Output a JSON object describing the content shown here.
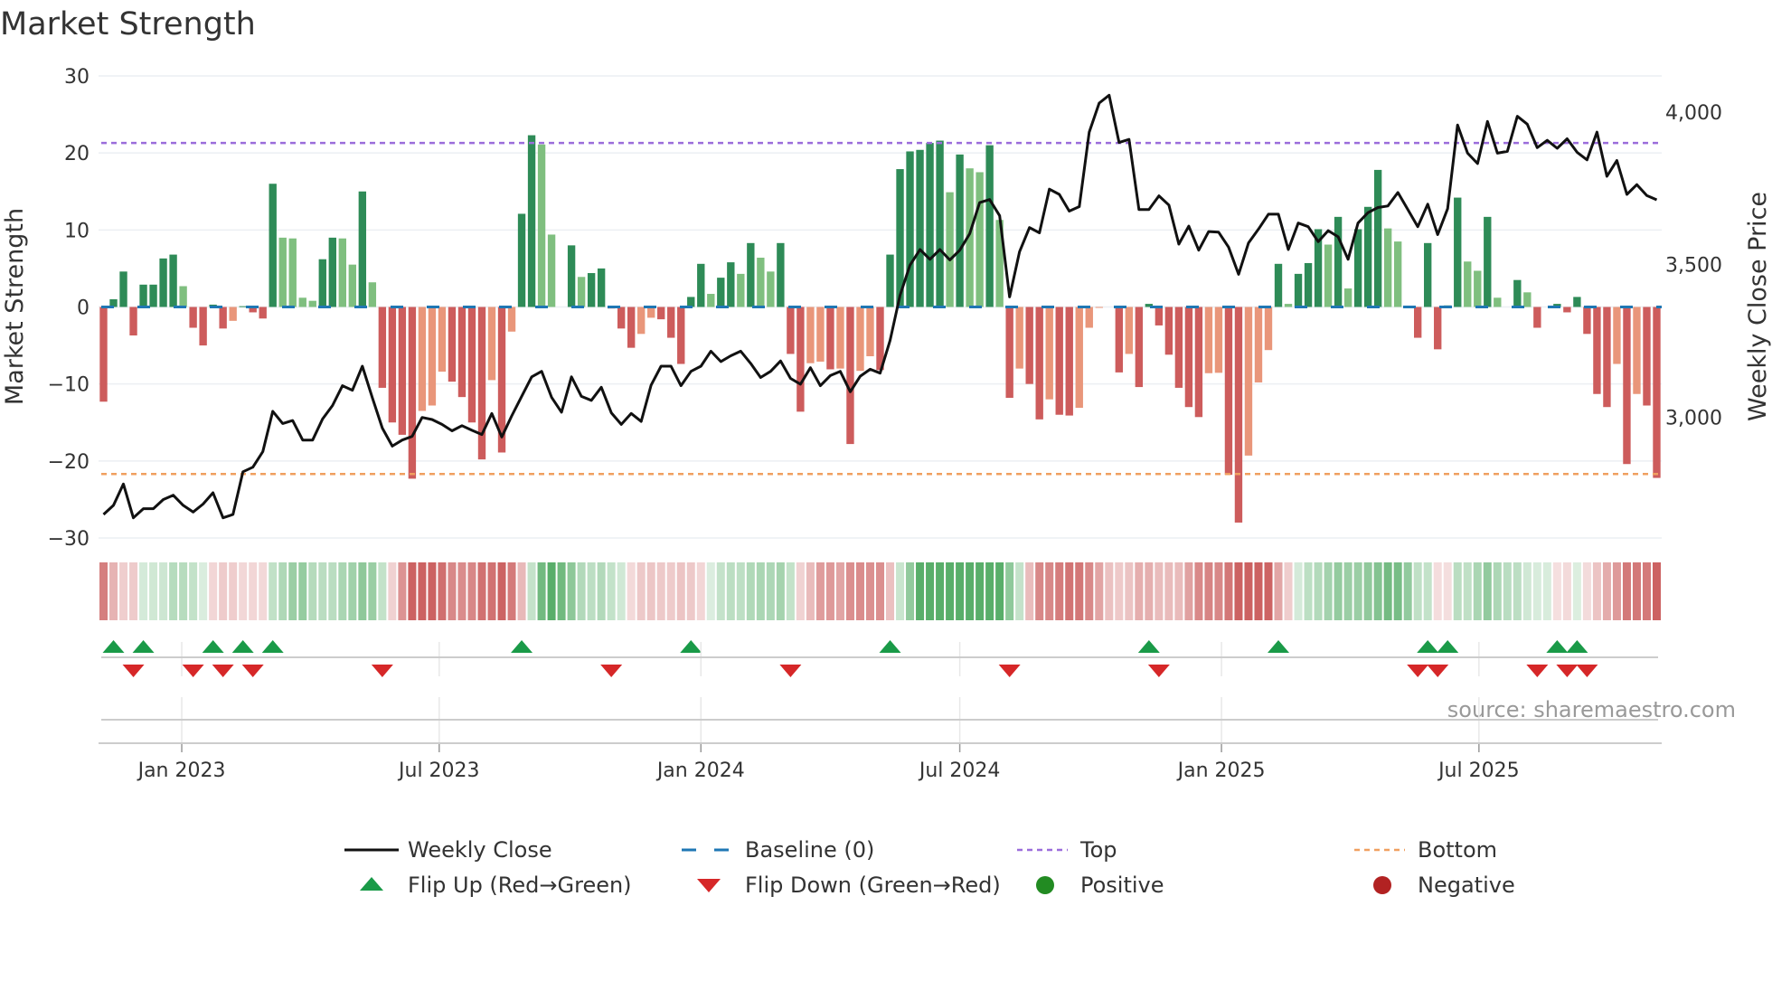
{
  "chart_data": {
    "type": "bar",
    "title": "Market Strength",
    "ylabel": "Market Strength",
    "ylabel_right": "Weekly Close Price",
    "source": "source: sharemaestro.com",
    "ylim": [
      -30,
      30
    ],
    "yticks": [
      30,
      20,
      10,
      0,
      -10,
      -20,
      -30
    ],
    "ytick_labels": [
      "30",
      "20",
      "10",
      "0",
      "−10",
      "−20",
      "−30"
    ],
    "ylim_right": [
      2604,
      4118
    ],
    "yticks_right": [
      4000,
      3500,
      3000
    ],
    "ytick_labels_right": [
      "4,000",
      "3,500",
      "3,000"
    ],
    "xticks": [
      {
        "date": "2023-01-01",
        "label": "Jan 2023"
      },
      {
        "date": "2023-07-01",
        "label": "Jul 2023"
      },
      {
        "date": "2024-01-01",
        "label": "Jan 2024"
      },
      {
        "date": "2024-07-01",
        "label": "Jul 2024"
      },
      {
        "date": "2025-01-01",
        "label": "Jan 2025"
      },
      {
        "date": "2025-07-01",
        "label": "Jul 2025"
      }
    ],
    "start_week": "2022-11-07",
    "interval_days": 7,
    "top_level": 21.3,
    "bottom_level": -21.7,
    "strength": [
      -12.3,
      1.0,
      4.6,
      -3.7,
      2.9,
      2.9,
      6.3,
      6.8,
      2.7,
      -2.7,
      -5.0,
      0.3,
      -2.8,
      -1.8,
      0.1,
      -0.7,
      -1.5,
      16.0,
      9.0,
      8.9,
      1.2,
      0.8,
      6.2,
      9.0,
      8.9,
      5.5,
      15.0,
      3.2,
      -10.5,
      -15.0,
      -16.6,
      -22.3,
      -13.5,
      -12.8,
      -8.4,
      -9.7,
      -11.7,
      -15.0,
      -19.8,
      -9.5,
      -18.9,
      -3.2,
      12.1,
      22.3,
      21.1,
      9.4,
      0.0,
      8.0,
      3.9,
      4.4,
      5.0,
      -0.2,
      -2.8,
      -5.3,
      -3.5,
      -1.4,
      -1.6,
      -4.0,
      -7.4,
      1.3,
      5.6,
      1.7,
      3.8,
      5.8,
      4.3,
      8.3,
      6.4,
      4.6,
      8.3,
      -6.1,
      -13.6,
      -7.3,
      -7.1,
      -8.1,
      -8.0,
      -17.8,
      -8.3,
      -6.4,
      -8.2,
      6.8,
      17.9,
      20.2,
      20.4,
      21.3,
      21.6,
      14.9,
      19.8,
      18.0,
      17.5,
      21.0,
      11.3,
      -11.8,
      -8.0,
      -10.0,
      -14.6,
      -12.0,
      -14.0,
      -14.1,
      -13.1,
      -2.7,
      -0.1,
      0.0,
      -8.5,
      -6.1,
      -10.4,
      0.4,
      -2.4,
      -6.2,
      -10.5,
      -13.0,
      -14.3,
      -8.6,
      -8.55,
      -21.8,
      -28.0,
      -19.3,
      -9.8,
      -5.6,
      5.6,
      0.4,
      4.3,
      5.7,
      10.1,
      8.1,
      11.7,
      2.4,
      10.1,
      13.0,
      17.8,
      10.2,
      8.5,
      0.0,
      -4.0,
      8.3,
      -5.5,
      0.2,
      14.2,
      5.9,
      4.7,
      11.7,
      1.2,
      0.0,
      3.5,
      1.9,
      -2.7,
      0.0,
      0.4,
      -0.7,
      1.3,
      -3.5,
      -11.3,
      -13.0,
      -7.4,
      -20.4,
      -11.3,
      -12.8,
      -22.2
    ],
    "close": [
      2681,
      2711,
      2781,
      2670,
      2700,
      2700,
      2730,
      2744,
      2711,
      2689,
      2715,
      2752,
      2670,
      2681,
      2821,
      2836,
      2887,
      3019,
      2979,
      2989,
      2925,
      2925,
      2994,
      3038,
      3103,
      3088,
      3167,
      3063,
      2964,
      2905,
      2925,
      2937,
      2999,
      2992,
      2976,
      2955,
      2972,
      2957,
      2943,
      3012,
      2935,
      3004,
      3068,
      3132,
      3150,
      3065,
      3016,
      3132,
      3068,
      3055,
      3098,
      3014,
      2976,
      3012,
      2986,
      3105,
      3167,
      3167,
      3103,
      3150,
      3167,
      3216,
      3182,
      3201,
      3216,
      3176,
      3130,
      3150,
      3184,
      3127,
      3108,
      3162,
      3103,
      3136,
      3150,
      3083,
      3134,
      3157,
      3144,
      3251,
      3399,
      3498,
      3549,
      3517,
      3549,
      3515,
      3547,
      3601,
      3703,
      3713,
      3660,
      3394,
      3542,
      3621,
      3604,
      3747,
      3730,
      3675,
      3690,
      3934,
      4029,
      4055,
      3900,
      3910,
      3680,
      3680,
      3725,
      3695,
      3567,
      3626,
      3547,
      3608,
      3606,
      3557,
      3468,
      3571,
      3616,
      3665,
      3665,
      3549,
      3636,
      3624,
      3575,
      3611,
      3591,
      3517,
      3636,
      3670,
      3687,
      3692,
      3736,
      3680,
      3624,
      3698,
      3598,
      3683,
      3957,
      3865,
      3831,
      3969,
      3865,
      3871,
      3986,
      3960,
      3883,
      3907,
      3881,
      3912,
      3868,
      3843,
      3934,
      3789,
      3841,
      3730,
      3762,
      3726,
      3712
    ],
    "flip_up_weeks": [
      1,
      4,
      11,
      14,
      17,
      42,
      59,
      79,
      105,
      118,
      133,
      135,
      146,
      148
    ],
    "flip_down_weeks": [
      3,
      9,
      12,
      15,
      28,
      51,
      69,
      91,
      106,
      132,
      134,
      144,
      147,
      149
    ],
    "colors": {
      "strong_positive": "#2e8b57",
      "weak_positive": "#7fbf7f",
      "strong_negative": "#cd5c5c",
      "weak_negative": "#e9967a",
      "close_line": "#111111",
      "baseline": "#1f77b4",
      "top": "#9b6ddb",
      "bottom": "#f0a060",
      "flip_up": "#1a9a48",
      "flip_down": "#d62728",
      "positive": "#228b22",
      "negative": "#b22222"
    },
    "legend": [
      {
        "key": "close",
        "label": "Weekly Close"
      },
      {
        "key": "baseline",
        "label": "Baseline (0)"
      },
      {
        "key": "top",
        "label": "Top"
      },
      {
        "key": "bottom",
        "label": "Bottom"
      },
      {
        "key": "flip_up",
        "label": "Flip Up (Red→Green)"
      },
      {
        "key": "flip_down",
        "label": "Flip Down (Green→Red)"
      },
      {
        "key": "positive",
        "label": "Positive"
      },
      {
        "key": "negative",
        "label": "Negative"
      }
    ],
    "legend_position": "bottom",
    "grid": true
  }
}
